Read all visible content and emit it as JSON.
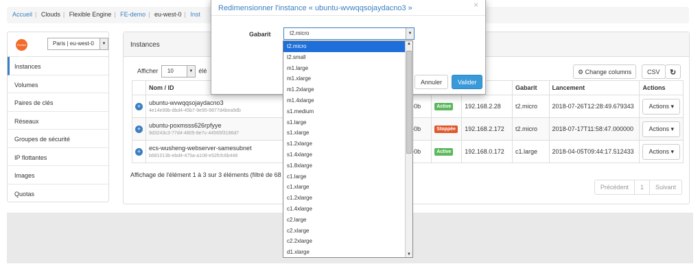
{
  "breadcrumb": [
    "Accueil",
    "Clouds",
    "Flexible Engine",
    "FE-demo",
    "eu-west-0",
    "Inst"
  ],
  "region": {
    "logo_text": "Flexible Engine",
    "selected": "Paris | eu-west-0",
    "arrow": "▼"
  },
  "sidebar": {
    "items": [
      {
        "label": "Instances"
      },
      {
        "label": "Volumes"
      },
      {
        "label": "Paires de clés"
      },
      {
        "label": "Réseaux"
      },
      {
        "label": "Groupes de sécurité"
      },
      {
        "label": "IP flottantes"
      },
      {
        "label": "Images"
      },
      {
        "label": "Quotas"
      }
    ]
  },
  "main": {
    "title": "Instances",
    "show_prefix": "Afficher",
    "show_value": "10",
    "show_suffix": "élé",
    "change_columns": "Change columns",
    "csv": "CSV",
    "refresh_icon": "↻",
    "gear_icon": "⚙",
    "columns": [
      "Nom / ID",
      "e",
      "Gabarit",
      "Lancement",
      "Actions"
    ],
    "rows": [
      {
        "name": "ubuntu-wvwqqsojaydacno3",
        "id": "4e14e99b-dbd4-45b7-9e95-9877d4bea9db",
        "az": "t-0b",
        "status": "Active",
        "status_color": "#5cb85c",
        "ip": "192.168.2.28",
        "flavor": "t2.micro",
        "launch": "2018-07-26T12:28:49.679343",
        "action": "Actions"
      },
      {
        "name": "ubuntu-poxmsss626rpfyye",
        "id": "9d3243c3-77d4-4805-8e7c-44565f3186d7",
        "az": "t-0b",
        "status": "Stoppée",
        "status_color": "#e0572c",
        "ip": "192.168.2.172",
        "flavor": "t2.micro",
        "launch": "2018-07-17T11:58:47.000000",
        "action": "Actions"
      },
      {
        "name": "ecs-wusheng-webserver-samesubnet",
        "id": "b681013b-ebd4-475a-a108-e52fcfc6b448",
        "az": "t-0b",
        "status": "Active",
        "status_color": "#5cb85c",
        "ip": "192.168.0.172",
        "flavor": "c1.large",
        "launch": "2018-04-05T09:44:17.512433",
        "action": "Actions"
      }
    ],
    "footer": "Affichage de l'élément 1 à 3 sur 3 éléments (filtré de 68",
    "pager": {
      "prev": "Précédent",
      "page": "1",
      "next": "Suivant"
    }
  },
  "modal": {
    "title": "Redimensionner l'instance « ubuntu-wvwqqsojaydacno3 »",
    "close": "×",
    "label": "Gabarit",
    "selected": "t2.micro",
    "cancel": "Annuler",
    "submit": "Valider",
    "submit_color": "#3a9ad9"
  },
  "dropdown": {
    "options": [
      "t2.micro",
      "t2.small",
      "m1.large",
      "m1.xlarge",
      "m1.2xlarge",
      "m1.4xlarge",
      "s1.medium",
      "s1.large",
      "s1.xlarge",
      "s1.2xlarge",
      "s1.4xlarge",
      "s1.8xlarge",
      "c1.large",
      "c1.xlarge",
      "c1.2xlarge",
      "c1.4xlarge",
      "c2.large",
      "c2.xlarge",
      "c2.2xlarge",
      "d1.xlarge"
    ]
  }
}
